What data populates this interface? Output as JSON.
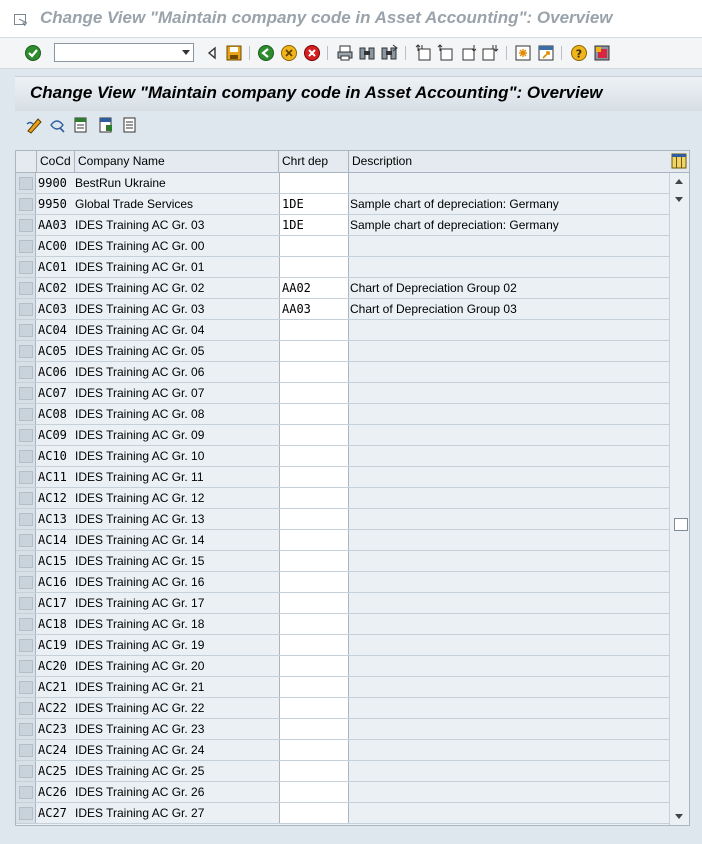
{
  "window": {
    "title": "Change View \"Maintain company code in Asset Accounting\": Overview"
  },
  "toolbar": {
    "command_value": ""
  },
  "screen": {
    "title": "Change View \"Maintain company code in Asset Accounting\": Overview"
  },
  "table": {
    "columns": [
      "CoCd",
      "Company Name",
      "Chrt dep",
      "Description"
    ],
    "rows": [
      {
        "cocd": "9900",
        "name": "BestRun Ukraine",
        "chrt": "",
        "desc": ""
      },
      {
        "cocd": "9950",
        "name": "Global Trade Services",
        "chrt": "1DE",
        "desc": "Sample chart of depreciation: Germany"
      },
      {
        "cocd": "AA03",
        "name": "IDES Training AC Gr. 03",
        "chrt": "1DE",
        "desc": "Sample chart of depreciation: Germany"
      },
      {
        "cocd": "AC00",
        "name": "IDES Training AC Gr. 00",
        "chrt": "",
        "desc": ""
      },
      {
        "cocd": "AC01",
        "name": "IDES Training AC Gr. 01",
        "chrt": "",
        "desc": ""
      },
      {
        "cocd": "AC02",
        "name": "IDES Training AC Gr. 02",
        "chrt": "AA02",
        "desc": "Chart of Depreciation Group 02"
      },
      {
        "cocd": "AC03",
        "name": "IDES Training AC Gr. 03",
        "chrt": "AA03",
        "desc": "Chart of Depreciation Group 03"
      },
      {
        "cocd": "AC04",
        "name": "IDES Training AC Gr. 04",
        "chrt": "",
        "desc": ""
      },
      {
        "cocd": "AC05",
        "name": "IDES Training AC Gr. 05",
        "chrt": "",
        "desc": ""
      },
      {
        "cocd": "AC06",
        "name": "IDES Training AC Gr. 06",
        "chrt": "",
        "desc": ""
      },
      {
        "cocd": "AC07",
        "name": "IDES Training AC Gr. 07",
        "chrt": "",
        "desc": ""
      },
      {
        "cocd": "AC08",
        "name": "IDES Training AC Gr. 08",
        "chrt": "",
        "desc": ""
      },
      {
        "cocd": "AC09",
        "name": "IDES Training AC Gr. 09",
        "chrt": "",
        "desc": ""
      },
      {
        "cocd": "AC10",
        "name": "IDES Training AC Gr. 10",
        "chrt": "",
        "desc": ""
      },
      {
        "cocd": "AC11",
        "name": "IDES Training AC Gr. 11",
        "chrt": "",
        "desc": ""
      },
      {
        "cocd": "AC12",
        "name": "IDES Training AC Gr. 12",
        "chrt": "",
        "desc": ""
      },
      {
        "cocd": "AC13",
        "name": "IDES Training AC Gr. 13",
        "chrt": "",
        "desc": ""
      },
      {
        "cocd": "AC14",
        "name": "IDES Training AC Gr. 14",
        "chrt": "",
        "desc": ""
      },
      {
        "cocd": "AC15",
        "name": "IDES Training AC Gr. 15",
        "chrt": "",
        "desc": ""
      },
      {
        "cocd": "AC16",
        "name": "IDES Training AC Gr. 16",
        "chrt": "",
        "desc": ""
      },
      {
        "cocd": "AC17",
        "name": "IDES Training AC Gr. 17",
        "chrt": "",
        "desc": ""
      },
      {
        "cocd": "AC18",
        "name": "IDES Training AC Gr. 18",
        "chrt": "",
        "desc": ""
      },
      {
        "cocd": "AC19",
        "name": "IDES Training AC Gr. 19",
        "chrt": "",
        "desc": ""
      },
      {
        "cocd": "AC20",
        "name": "IDES Training AC Gr. 20",
        "chrt": "",
        "desc": ""
      },
      {
        "cocd": "AC21",
        "name": "IDES Training AC Gr. 21",
        "chrt": "",
        "desc": ""
      },
      {
        "cocd": "AC22",
        "name": "IDES Training AC Gr. 22",
        "chrt": "",
        "desc": ""
      },
      {
        "cocd": "AC23",
        "name": "IDES Training AC Gr. 23",
        "chrt": "",
        "desc": ""
      },
      {
        "cocd": "AC24",
        "name": "IDES Training AC Gr. 24",
        "chrt": "",
        "desc": ""
      },
      {
        "cocd": "AC25",
        "name": "IDES Training AC Gr. 25",
        "chrt": "",
        "desc": ""
      },
      {
        "cocd": "AC26",
        "name": "IDES Training AC Gr. 26",
        "chrt": "",
        "desc": ""
      },
      {
        "cocd": "AC27",
        "name": "IDES Training AC Gr. 27",
        "chrt": "",
        "desc": ""
      }
    ]
  },
  "colors": {
    "title_gray": "#9aa3ab",
    "table_bg": "#eaf0f4",
    "window_bg": "#dfe7ee"
  }
}
